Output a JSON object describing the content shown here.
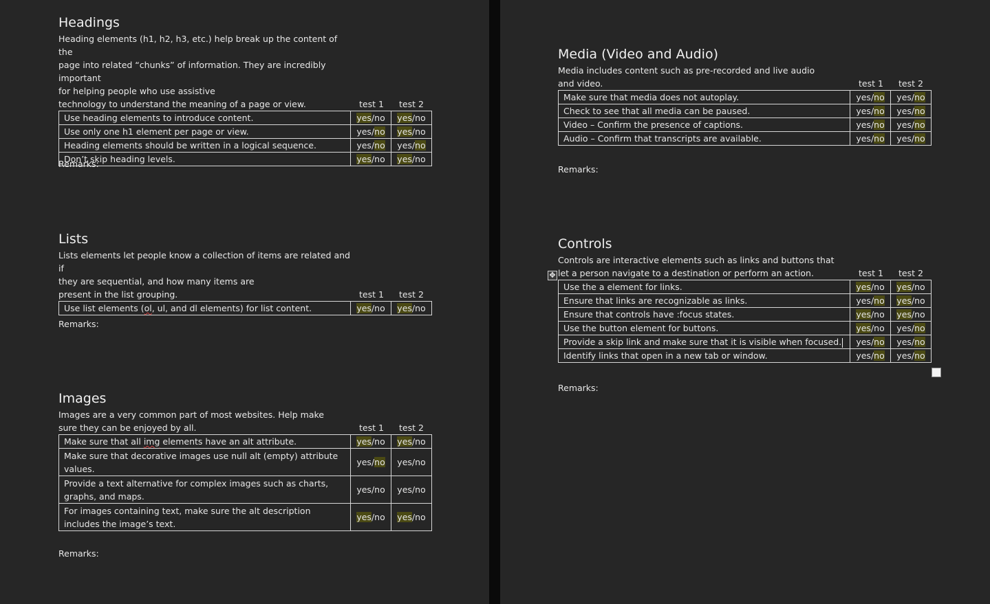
{
  "columns": {
    "test1": "test 1",
    "test2": "test 2"
  },
  "result_options": {
    "yes": "yes",
    "sep": "/",
    "no": "no"
  },
  "remarks_label": "Remarks:",
  "sections": {
    "headings": {
      "title": "Headings",
      "intro": "Heading elements (h1, h2, h3, etc.) help break up the content of the\npage into related “chunks” of information. They are incredibly important\nfor helping people who use assistive\ntechnology to understand the meaning of a page or view.",
      "rows": [
        {
          "text": "Use heading elements to introduce content.",
          "t1": "yes",
          "t2": "yes"
        },
        {
          "text": "Use only one h1 element per page or view.",
          "t1": "no",
          "t2": "yes"
        },
        {
          "text": "Heading elements should be written in a logical sequence.",
          "t1": "no",
          "t2": "no"
        },
        {
          "text": "Don’t skip heading levels.",
          "t1": "yes",
          "t2": "yes"
        }
      ]
    },
    "lists": {
      "title": "Lists",
      "intro": "Lists elements let people know a collection of items are related and if\nthey are sequential, and how many items are\npresent in the list grouping.",
      "rows": [
        {
          "text_pre": "Use list elements (",
          "text_squiggle": "ol",
          "text_post": ", ul, and dl elements) for list content.",
          "t1": "yes",
          "t2": "yes"
        }
      ]
    },
    "images": {
      "title": "Images",
      "intro": "Images are a very common part of most websites. Help make\nsure they can be enjoyed by all.",
      "rows": [
        {
          "text_pre": "Make sure that all ",
          "text_squiggle": "img",
          "text_post": " elements have an alt attribute.",
          "t1": "yes",
          "t2": "yes"
        },
        {
          "text": "Make sure that decorative images use null alt (empty) attribute values.",
          "t1": "no",
          "t2": ""
        },
        {
          "text": "Provide a text alternative for complex images such as charts, graphs, and maps.",
          "t1": "",
          "t2": ""
        },
        {
          "text": "For images containing text, make sure the alt description includes the image’s text.",
          "t1": "yes",
          "t2": "yes"
        }
      ]
    },
    "media": {
      "title": "Media (Video and Audio)",
      "intro": "Media includes content such as pre-recorded and live audio\nand video.",
      "rows": [
        {
          "text": "Make sure that media does not autoplay.",
          "t1": "no",
          "t2": "no"
        },
        {
          "text": "Check to see that all media can be paused.",
          "t1": "no",
          "t2": "no"
        },
        {
          "text": "Video – Confirm the presence of captions.",
          "t1": "no",
          "t2": "no"
        },
        {
          "text": "Audio – Confirm that transcripts are available.",
          "t1": "no",
          "t2": "no"
        }
      ]
    },
    "controls": {
      "title": "Controls",
      "intro": "Controls are interactive elements such as links and buttons that\nlet a person navigate to a destination or perform an action.",
      "rows": [
        {
          "text": "Use the a element for links.",
          "t1": "yes",
          "t2": "yes"
        },
        {
          "text": "Ensure that links are recognizable as links.",
          "t1": "no",
          "t2": "yes"
        },
        {
          "text": "Ensure that controls have :focus states.",
          "t1": "yes",
          "t2": "yes"
        },
        {
          "text": "Use the button element for buttons.",
          "t1": "yes",
          "t2": "no"
        },
        {
          "text": "Provide a skip link and make sure that it is visible when focused.",
          "t1": "no",
          "t2": "no"
        },
        {
          "text": "Identify links that open in a new tab or window.",
          "t1": "no",
          "t2": "no"
        }
      ]
    }
  }
}
